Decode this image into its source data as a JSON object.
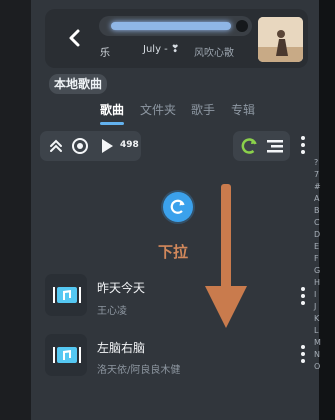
{
  "ticker": {
    "left_partial": "乐",
    "current": "July - ❣",
    "right_partial": "风吹心散"
  },
  "section": {
    "title": "本地歌曲"
  },
  "tabs": [
    {
      "label": "歌曲",
      "active": true
    },
    {
      "label": "文件夹",
      "active": false
    },
    {
      "label": "歌手",
      "active": false
    },
    {
      "label": "专辑",
      "active": false
    }
  ],
  "controls": {
    "count": "498"
  },
  "pull": {
    "label": "下拉"
  },
  "songs": [
    {
      "title": "昨天今天",
      "artist": "王心凌"
    },
    {
      "title": "左脑右脑",
      "artist": "洛天依/阿良良木健"
    }
  ],
  "alphabet": [
    "?",
    "7",
    "#",
    "A",
    "B",
    "C",
    "D",
    "E",
    "F",
    "G",
    "H",
    "I",
    "J",
    "K",
    "L",
    "M",
    "N",
    "O"
  ],
  "colors": {
    "accent": "#3ba1ec",
    "arrow": "#c97b4d",
    "panel": "#31363c"
  }
}
